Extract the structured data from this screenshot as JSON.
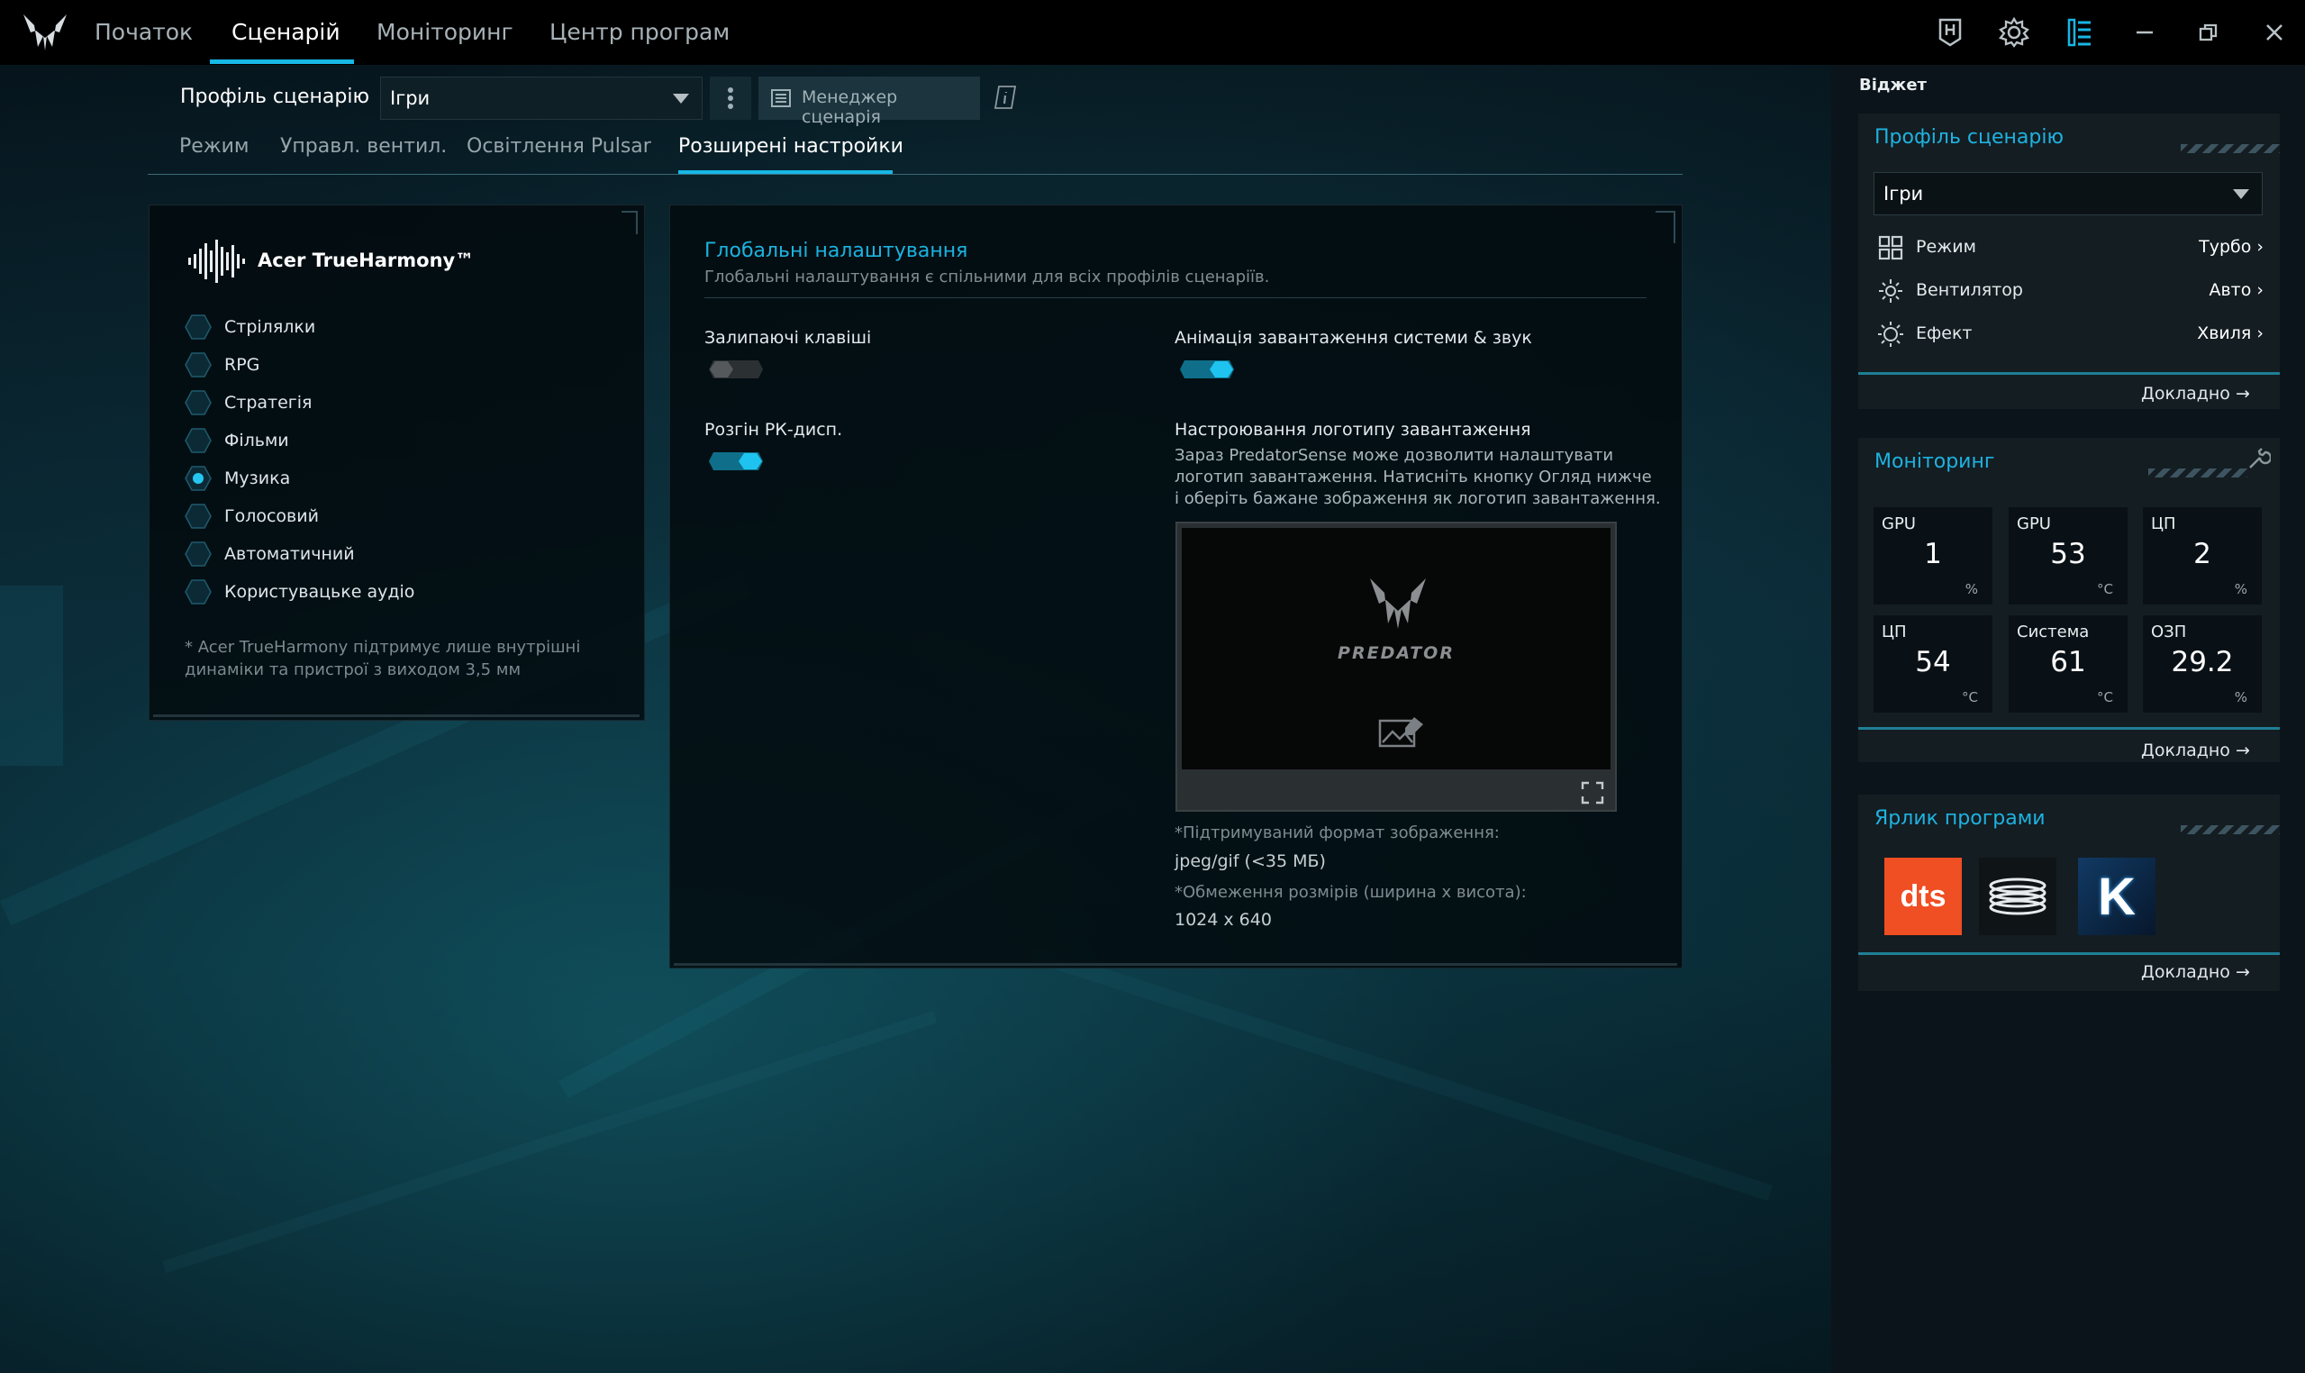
{
  "nav": {
    "items": [
      "Початок",
      "Сценарій",
      "Моніторинг",
      "Центр програм"
    ],
    "active_index": 1
  },
  "window": {
    "icons": [
      "keyboard-icon",
      "settings-gear-icon",
      "widget-panel-icon",
      "minimize-icon",
      "restore-icon",
      "close-icon"
    ]
  },
  "profile": {
    "label": "Профіль сценарію",
    "selected": "Ігри",
    "manager_label": "Менеджер сценарія"
  },
  "subtabs": {
    "items": [
      "Режим",
      "Управл. вентил.",
      "Освітлення Pulsar",
      "Розширені настройки"
    ],
    "active_index": 3
  },
  "trueharmony": {
    "title": "Acer TrueHarmony™",
    "options": [
      "Стрілялки",
      "RPG",
      "Стратегія",
      "Фільми",
      "Музика",
      "Голосовий",
      "Автоматичний",
      "Користувацьке аудіо"
    ],
    "selected_index": 4,
    "note": "* Acer TrueHarmony підтримує лише внутрішні динаміки та пристрої з виходом 3,5 мм"
  },
  "global": {
    "title": "Глобальні налаштування",
    "subtitle": "Глобальні налаштування є спільними для всіх профілів сценаріїв.",
    "sticky_keys": {
      "label": "Залипаючі клавіші",
      "on": false
    },
    "boot_anim": {
      "label": "Анімація завантаження системи & звук",
      "on": true
    },
    "lcd_overdrive": {
      "label": "Розгін РК-дисп.",
      "on": true
    },
    "boot_logo": {
      "title": "Настроювання логотипу завантаження",
      "description": "Зараз PredatorSense може дозволити налаштувати логотип завантаження. Натисніть кнопку Огляд нижче і оберіть бажане зображення як логотип завантаження.",
      "preview_text": "PREDATOR",
      "format_label": "*Підтримуваний формат зображення:",
      "format_value": "jpeg/gif (<35 МБ)",
      "size_label": "*Обмеження розмірів (ширина x висота):",
      "size_value": "1024 x 640"
    }
  },
  "widget": {
    "header": "Віджет",
    "profile_card": {
      "title": "Профіль сценарію",
      "selected": "Ігри",
      "rows": [
        {
          "name": "Режим",
          "value": "Турбо",
          "icon": "grid-icon"
        },
        {
          "name": "Вентилятор",
          "value": "Авто",
          "icon": "fan-icon"
        },
        {
          "name": "Ефект",
          "value": "Хвиля",
          "icon": "sun-effect-icon"
        }
      ],
      "more": "Докладно"
    },
    "monitor_card": {
      "title": "Моніторинг",
      "tiles": [
        {
          "name": "GPU",
          "value": "1",
          "unit": "%"
        },
        {
          "name": "GPU",
          "value": "53",
          "unit": "°C"
        },
        {
          "name": "ЦП",
          "value": "2",
          "unit": "%"
        },
        {
          "name": "ЦП",
          "value": "54",
          "unit": "°C"
        },
        {
          "name": "Система",
          "value": "61",
          "unit": "°C"
        },
        {
          "name": "ОЗП",
          "value": "29.2",
          "unit": "%"
        }
      ],
      "more": "Докладно"
    },
    "apps_card": {
      "title": "Ярлик програми",
      "apps": [
        {
          "name": "dts-app-icon",
          "text": "dts",
          "color": "#f04e23"
        },
        {
          "name": "coil-app-icon",
          "text": "",
          "color": "#0f1417"
        },
        {
          "name": "killer-app-icon",
          "text": "K",
          "color": "#0d2a48"
        }
      ],
      "more": "Докладно"
    }
  },
  "colors": {
    "accent": "#17b7e6",
    "toggle_on": "#12b7e0",
    "toggle_off": "#3a3f42"
  }
}
